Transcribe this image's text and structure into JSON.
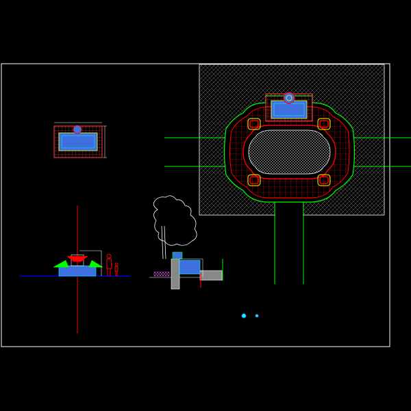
{
  "drawing": {
    "background": "#000000",
    "colors": {
      "border": "#ffffff",
      "hatch": "#ffffff",
      "red": "#ff0000",
      "green": "#00ff00",
      "blue": "#0000ff",
      "cyan": "#00ffff",
      "yellow": "#ffff00",
      "magenta": "#ff00ff",
      "lightblue": "#3f6fdf"
    },
    "views": [
      {
        "name": "small-plan-view"
      },
      {
        "name": "large-plan-view"
      },
      {
        "name": "front-elevation-view"
      },
      {
        "name": "section-view"
      },
      {
        "name": "legend-marks"
      }
    ]
  }
}
